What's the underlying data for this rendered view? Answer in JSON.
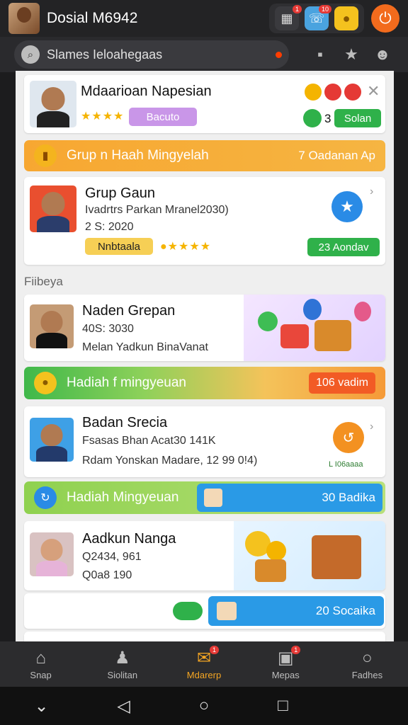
{
  "header": {
    "title": "Dosial M6942",
    "badges": {
      "grid": "1",
      "chat": "10",
      "coins": ""
    }
  },
  "search": {
    "placeholder": "Slames Ieloahegaas"
  },
  "card1": {
    "name": "Mdaarioan Napesian",
    "rating_label": "Bacuto",
    "action_label": "Solan",
    "count": "3"
  },
  "banner1": {
    "label": "Grup n Haah Mingyelah",
    "right": "7 Oadanan Ap"
  },
  "card2": {
    "name": "Grup Gaun",
    "line1": "Ivadrtrs Parkan Mranel2030)",
    "line2": "2 S: 2020",
    "tag": "Nnbtaala",
    "action_label": "23 Aondav"
  },
  "section_label": "Fiibeya",
  "card3": {
    "name": "Naden Grepan",
    "line1": "40S: 3030",
    "line2": "Melan Yadkun BinaVanat"
  },
  "banner2": {
    "label": "Hadiah f mingyeuan",
    "right": "106 vadim"
  },
  "card4": {
    "name": "Badan Srecia",
    "line1": "Fsasas Bhan Acat30 141K",
    "line2": "Rdam Yonskan Madare, 12 99 0!4)",
    "action_label": "L I06aaaa"
  },
  "banner3": {
    "label": "Hadiah Mingyeuan",
    "right": "30 Badika"
  },
  "card5": {
    "name": "Aadkun Nanga",
    "line1": "Q2434, 961",
    "line2": "Q0a8 190"
  },
  "row6": {
    "right": "20 Socaika"
  },
  "nav": [
    {
      "label": "Snap"
    },
    {
      "label": "Siolitan"
    },
    {
      "label": "Mdarerp",
      "badge": "1"
    },
    {
      "label": "Mepas",
      "badge": "1"
    },
    {
      "label": "Fadhes"
    }
  ]
}
